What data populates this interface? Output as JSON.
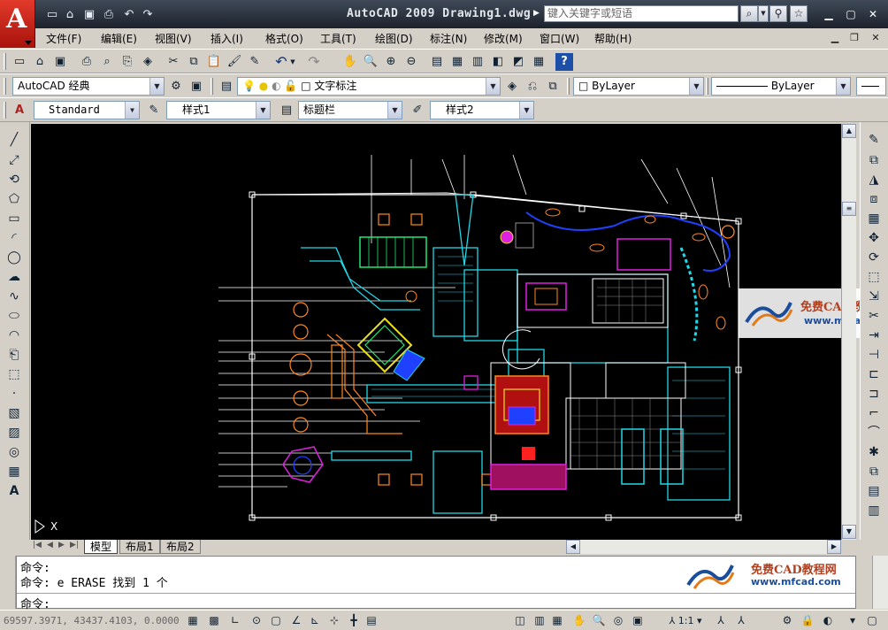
{
  "window": {
    "title": "AutoCAD 2009 Drawing1.dwg",
    "search_placeholder": "键入关键字或短语"
  },
  "menus": [
    "文件(F)",
    "编辑(E)",
    "视图(V)",
    "插入(I)",
    "格式(O)",
    "工具(T)",
    "绘图(D)",
    "标注(N)",
    "修改(M)",
    "窗口(W)",
    "帮助(H)"
  ],
  "workspace": {
    "selected": "AutoCAD 经典"
  },
  "layer": {
    "selected": "文字标注"
  },
  "properties": {
    "color": "ByLayer",
    "linetype": "ByLayer"
  },
  "styles": {
    "text_style": "Standard",
    "dim_style": "样式1",
    "table_style": "标题栏",
    "multileader_style": "样式2"
  },
  "layout_tabs": [
    "模型",
    "布局1",
    "布局2"
  ],
  "ucs_label": "X",
  "command": {
    "lines": [
      "命令:",
      "命令: e ERASE 找到 1 个"
    ],
    "prompt": "命令:"
  },
  "status": {
    "coordinates": "69597.3971, 43437.4103, 0.0000",
    "annotation_scale": "1:1"
  },
  "watermark": {
    "brand": "免费CAD教程网",
    "url": "www.mfcad.com"
  },
  "colors": {
    "canvas": "#000000",
    "title_bar": "#2a323e",
    "app_logo": "#c8201a",
    "cyan": "#22d8e8",
    "yellow": "#f0e020",
    "magenta": "#e020e0",
    "blue": "#2040ff",
    "red": "#ff2020"
  }
}
